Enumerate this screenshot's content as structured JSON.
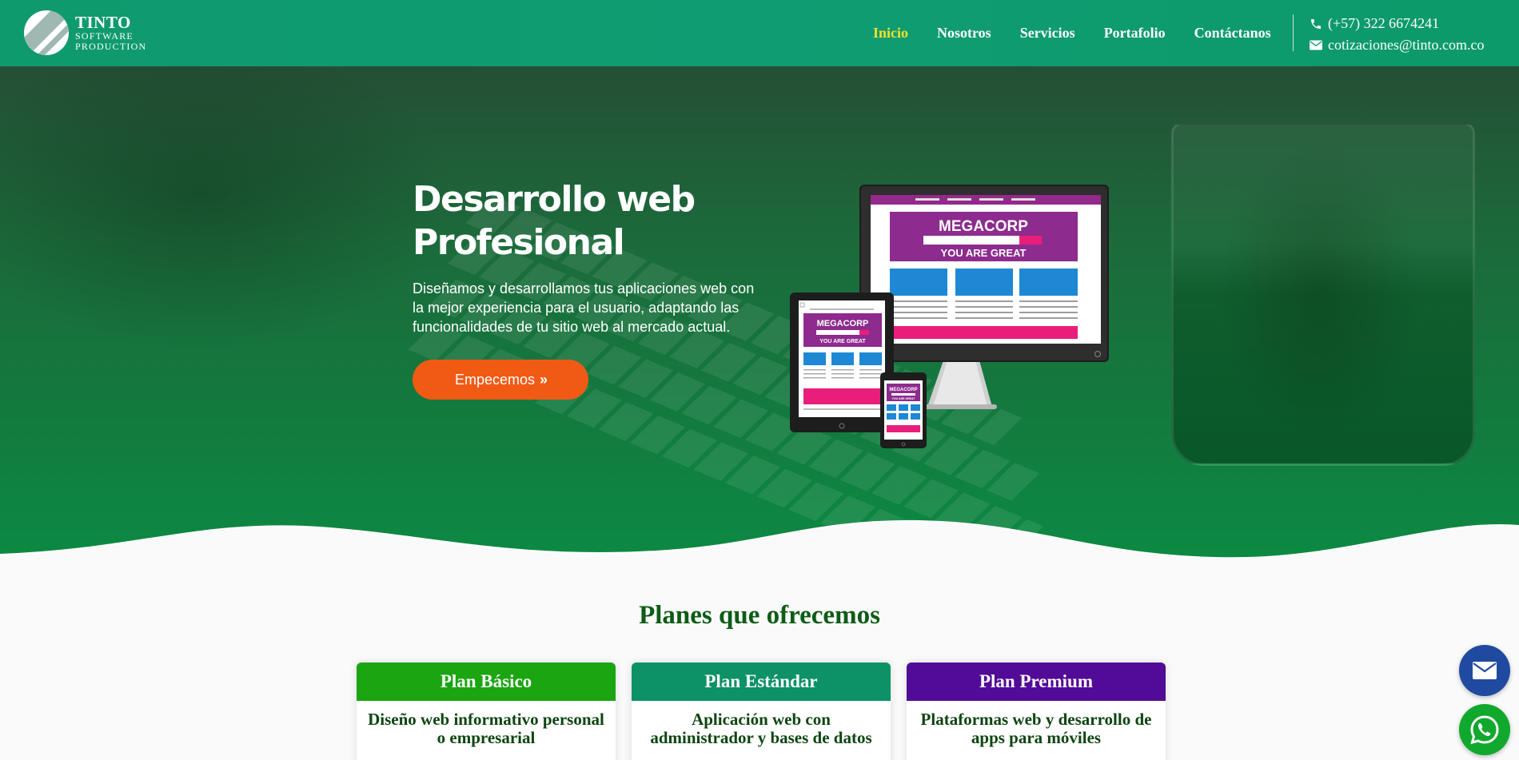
{
  "header": {
    "logo": {
      "name": "TINTO",
      "sub1": "SOFTWARE",
      "sub2": "PRODUCTION"
    },
    "nav": [
      {
        "label": "Inicio",
        "active": true
      },
      {
        "label": "Nosotros",
        "active": false
      },
      {
        "label": "Servicios",
        "active": false
      },
      {
        "label": "Portafolio",
        "active": false
      },
      {
        "label": "Contáctanos",
        "active": false
      }
    ],
    "contact": {
      "phone": "(+57) 322 6674241",
      "email": "cotizaciones@tinto.com.co"
    },
    "colors": {
      "bar": "#0f9a6e",
      "active_link": "#f2e12a"
    }
  },
  "hero": {
    "title_line1": "Desarrollo web",
    "title_line2": "Profesional",
    "description": "Diseñamos y desarrollamos tus aplicaciones web con la mejor experiencia para el usuario, adaptando las funcionalidades de tu sitio web al mercado actual.",
    "cta_label": "Empecemos",
    "cta_color": "#f15a14",
    "mockup": {
      "brand": "MEGACORP",
      "tagline": "YOU ARE GREAT"
    }
  },
  "plans": {
    "title": "Planes que ofrecemos",
    "items": [
      {
        "name": "Plan Básico",
        "description": "Diseño web informativo personal o empresarial",
        "color": "#1aa511"
      },
      {
        "name": "Plan Estándar",
        "description": "Aplicación web con administrador y bases de datos",
        "color": "#0d9166"
      },
      {
        "name": "Plan Premium",
        "description": "Plataformas web y desarrollo de apps para móviles",
        "color": "#520b96"
      }
    ]
  },
  "floating": {
    "mail_icon": "mail-icon",
    "whatsapp_icon": "whatsapp-icon"
  }
}
